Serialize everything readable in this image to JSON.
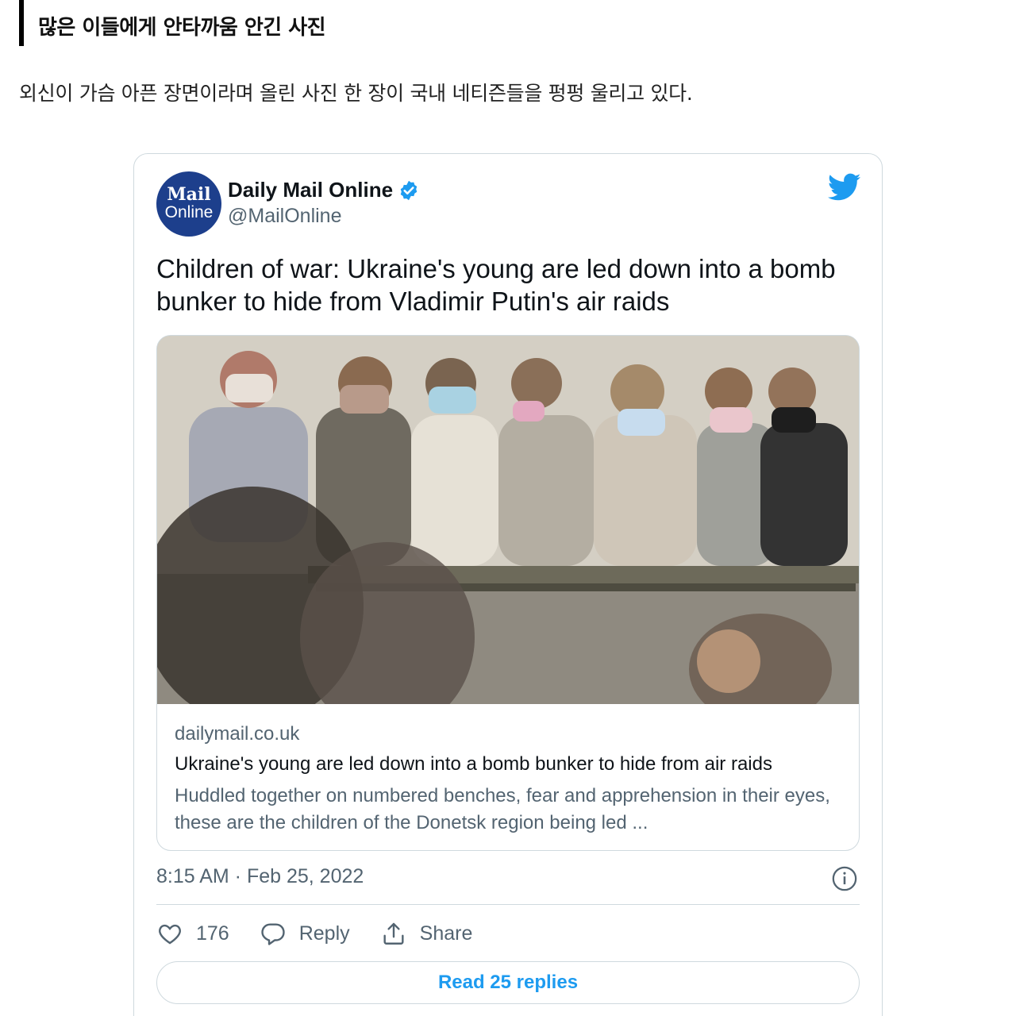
{
  "article": {
    "headline": "많은 이들에게 안타까움 안긴 사진",
    "lede": "외신이 가슴 아픈 장면이라며 올린 사진 한 장이 국내 네티즌들을 펑펑 울리고 있다."
  },
  "tweet": {
    "avatar": {
      "line1": "Mail",
      "line2": "Online",
      "color": "#1d3f8c"
    },
    "author_name": "Daily Mail Online",
    "handle": "@MailOnline",
    "text": "Children of war: Ukraine's young are led down into a bomb bunker to hide from Vladimir Putin's air raids",
    "card": {
      "domain": "dailymail.co.uk",
      "title": "Ukraine's young are led down into a bomb bunker to hide from air raids",
      "description": "Huddled together on numbered benches, fear and apprehension in their eyes, these are the children of the Donetsk region being led ..."
    },
    "timestamp": "8:15 AM · Feb 25, 2022",
    "actions": {
      "likes": "176",
      "reply_label": "Reply",
      "share_label": "Share"
    },
    "read_replies_label": "Read 25 replies",
    "accent_color": "#1d9bf0",
    "icons": [
      "twitter-bird-icon",
      "verified-badge-icon",
      "info-icon",
      "heart-icon",
      "reply-icon",
      "share-icon"
    ]
  }
}
